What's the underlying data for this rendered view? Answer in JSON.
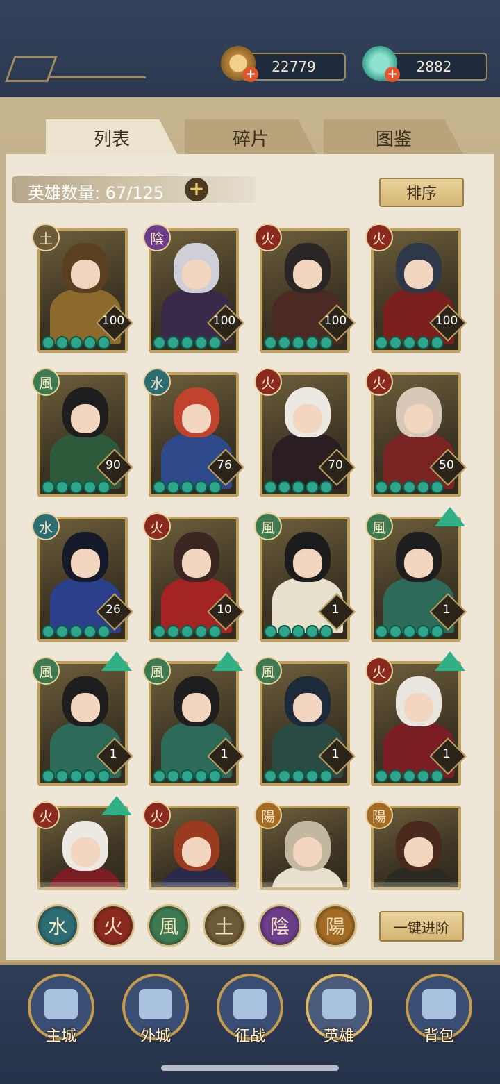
{
  "resources": {
    "coins": "22779",
    "jade": "2882",
    "plus": "+"
  },
  "tabs": [
    {
      "label": "列表",
      "active": true
    },
    {
      "label": "碎片",
      "active": false
    },
    {
      "label": "图鉴",
      "active": false
    }
  ],
  "hero_count": {
    "label": "英雄数量: 67/125",
    "add": "+"
  },
  "sort_label": "排序",
  "heroes": [
    {
      "element": "土",
      "level": "100",
      "stars": 5
    },
    {
      "element": "陰",
      "level": "100",
      "stars": 5
    },
    {
      "element": "火",
      "level": "100",
      "stars": 5
    },
    {
      "element": "火",
      "level": "100",
      "stars": 5
    },
    {
      "element": "風",
      "level": "90",
      "stars": 5
    },
    {
      "element": "水",
      "level": "76",
      "stars": 5
    },
    {
      "element": "火",
      "level": "70",
      "stars": 5
    },
    {
      "element": "火",
      "level": "50",
      "stars": 5
    },
    {
      "element": "水",
      "level": "26",
      "stars": 5
    },
    {
      "element": "火",
      "level": "10",
      "stars": 5
    },
    {
      "element": "風",
      "level": "1",
      "stars": 5
    },
    {
      "element": "風",
      "level": "1",
      "stars": 5,
      "upgrade": true
    },
    {
      "element": "風",
      "level": "1",
      "stars": 5,
      "upgrade": true
    },
    {
      "element": "風",
      "level": "1",
      "stars": 5,
      "upgrade": true
    },
    {
      "element": "風",
      "level": "1",
      "stars": 5
    },
    {
      "element": "火",
      "level": "1",
      "stars": 5,
      "upgrade": true
    },
    {
      "element": "火",
      "level": "",
      "stars": 0,
      "upgrade": true
    },
    {
      "element": "火",
      "level": "",
      "stars": 0
    },
    {
      "element": "陽",
      "level": "",
      "stars": 0
    },
    {
      "element": "陽",
      "level": "",
      "stars": 0
    }
  ],
  "element_filters": [
    "水",
    "火",
    "風",
    "土",
    "陰",
    "陽"
  ],
  "advance_label": "一键进阶",
  "nav": [
    {
      "label": "主城"
    },
    {
      "label": "外城"
    },
    {
      "label": "征战"
    },
    {
      "label": "英雄",
      "active": true
    },
    {
      "label": "背包"
    }
  ],
  "colors": {
    "water": "#2b6d73",
    "fire": "#8a2a1f",
    "wind": "#3d7a52",
    "earth": "#6d5a38",
    "yin": "#6c3d8a",
    "yang": "#a36b24",
    "accent_gold": "#c59c4d",
    "star_green": "#2fa58b"
  }
}
